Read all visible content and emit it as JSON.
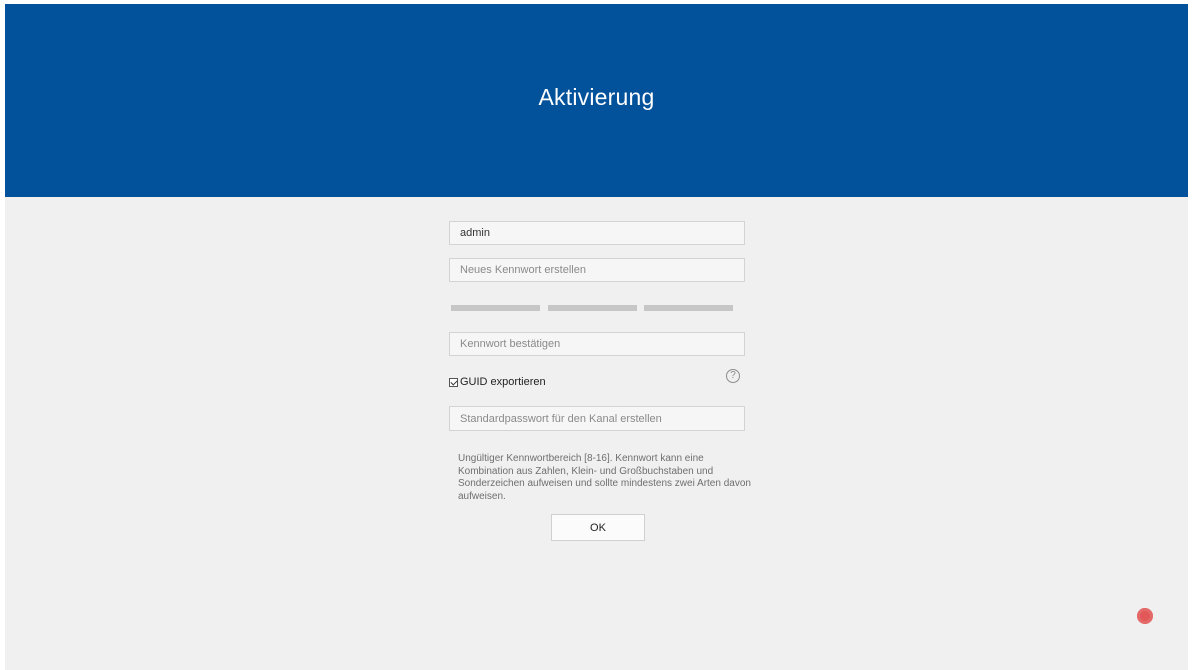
{
  "header": {
    "title": "Aktivierung"
  },
  "form": {
    "username_value": "admin",
    "new_password_placeholder": "Neues Kennwort erstellen",
    "confirm_password_placeholder": "Kennwort bestätigen",
    "guid_export_label": "GUID exportieren",
    "guid_export_checked": true,
    "help_icon_glyph": "?",
    "channel_password_placeholder": "Standardpasswort für den Kanal erstellen",
    "hint_text": "Ungültiger Kennwortbereich [8-16]. Kennwort kann eine Kombination aus Zahlen, Klein- und Großbuchstaben und Sonderzeichen aufweisen und sollte mindestens zwei Arten davon aufweisen.",
    "ok_label": "OK"
  },
  "colors": {
    "header_bg": "#02519b",
    "page_bg": "#f0f0f0",
    "strength_bar": "#c6c6c6",
    "status_dot": "#e25757"
  },
  "icons": {
    "help": "help-circle-icon",
    "checkbox": "checkbox-checked-icon",
    "status": "record-dot-icon"
  }
}
